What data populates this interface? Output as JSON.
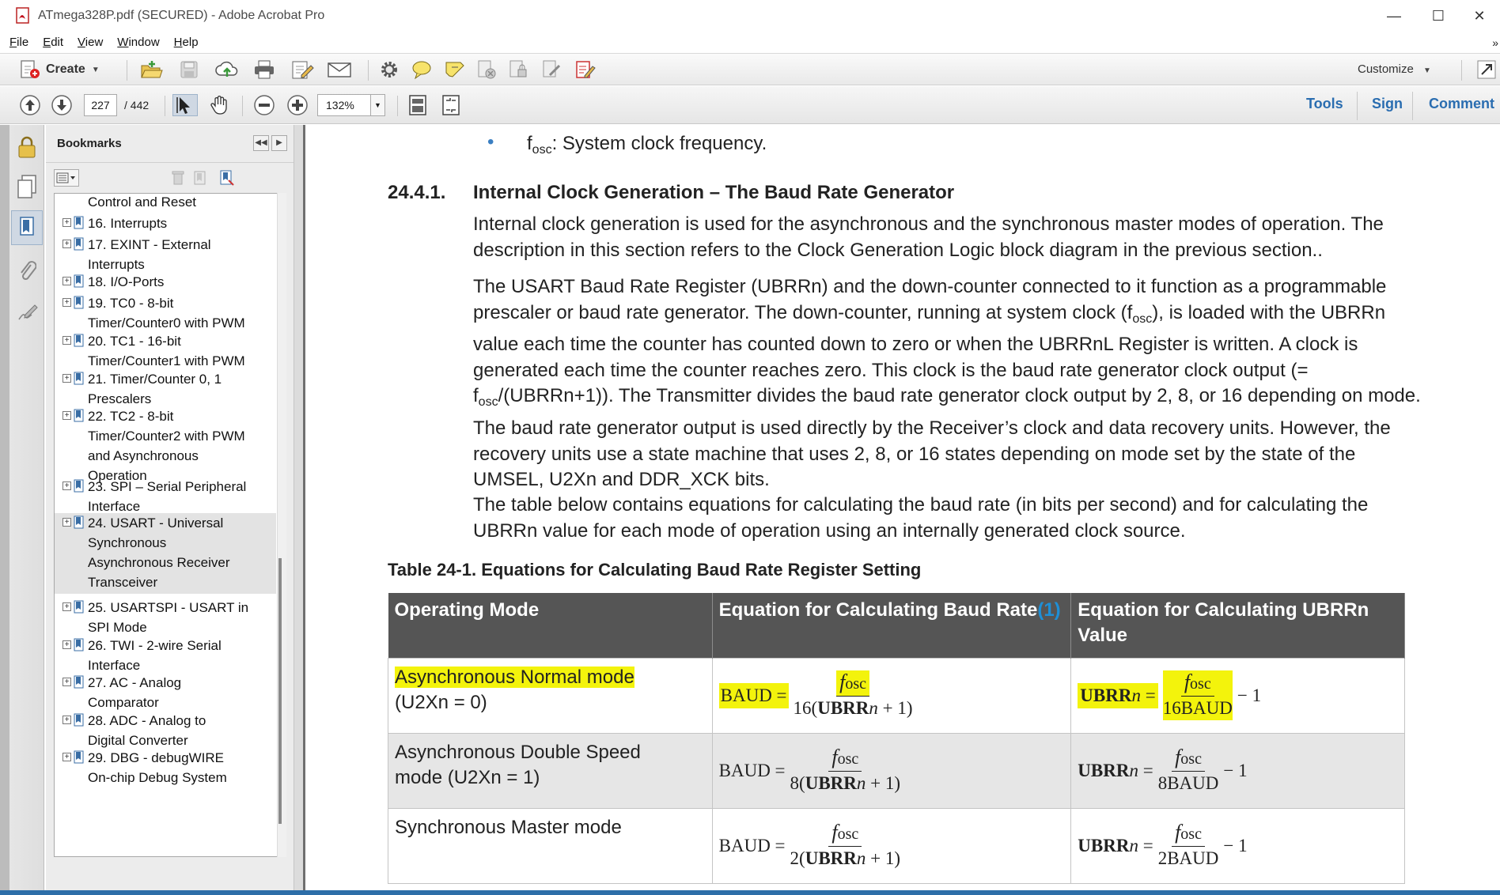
{
  "window": {
    "title": "ATmega328P.pdf (SECURED) - Adobe Acrobat Pro",
    "controls": {
      "minimize": "—",
      "maximize": "☐",
      "close": "✕"
    }
  },
  "menu": {
    "items": [
      {
        "key": "F",
        "rest": "ile"
      },
      {
        "key": "E",
        "rest": "dit"
      },
      {
        "key": "V",
        "rest": "iew"
      },
      {
        "key": "W",
        "rest": "indow"
      },
      {
        "key": "H",
        "rest": "elp"
      }
    ],
    "overflow": "»"
  },
  "toolbar": {
    "create_label": "Create",
    "customize_label": "Customize",
    "icons": [
      "open-folder-icon",
      "save-icon",
      "cloud-upload-icon",
      "print-icon",
      "edit-document-icon",
      "email-icon",
      "gear-icon",
      "comment-icon",
      "highlight-icon",
      "redact-icon",
      "secure-icon",
      "sign-icon",
      "pdf-form-icon"
    ]
  },
  "navigation": {
    "current_page": "227",
    "page_total": "/ 442",
    "zoom": "132%",
    "links": {
      "tools": "Tools",
      "sign": "Sign",
      "comment": "Comment"
    }
  },
  "bookmarks": {
    "title": "Bookmarks",
    "items": [
      {
        "lines": [
          "Control and Reset"
        ],
        "has_toggle": false,
        "selected": false
      },
      {
        "lines": [
          "16. Interrupts"
        ],
        "has_toggle": true,
        "selected": false
      },
      {
        "lines": [
          "17. EXINT - External",
          "Interrupts"
        ],
        "has_toggle": true,
        "selected": false
      },
      {
        "lines": [
          "18. I/O-Ports"
        ],
        "has_toggle": true,
        "selected": false
      },
      {
        "lines": [
          "19. TC0 - 8-bit",
          "Timer/Counter0 with PWM"
        ],
        "has_toggle": true,
        "selected": false
      },
      {
        "lines": [
          "20. TC1 - 16-bit",
          "Timer/Counter1 with PWM"
        ],
        "has_toggle": true,
        "selected": false
      },
      {
        "lines": [
          "21. Timer/Counter 0, 1",
          "Prescalers"
        ],
        "has_toggle": true,
        "selected": false
      },
      {
        "lines": [
          "22. TC2 - 8-bit",
          "Timer/Counter2 with PWM",
          "and Asynchronous",
          "Operation"
        ],
        "has_toggle": true,
        "selected": false
      },
      {
        "lines": [
          "23. SPI – Serial Peripheral",
          "Interface"
        ],
        "has_toggle": true,
        "selected": false
      },
      {
        "lines": [
          "24. USART - Universal",
          "Synchronous",
          "Asynchronous Receiver",
          "Transceiver"
        ],
        "has_toggle": true,
        "selected": true
      },
      {
        "lines": [
          "25. USARTSPI - USART in",
          "SPI Mode"
        ],
        "has_toggle": true,
        "selected": false
      },
      {
        "lines": [
          "26. TWI - 2-wire Serial",
          "Interface"
        ],
        "has_toggle": true,
        "selected": false
      },
      {
        "lines": [
          "27. AC - Analog",
          "Comparator"
        ],
        "has_toggle": true,
        "selected": false
      },
      {
        "lines": [
          "28. ADC - Analog to",
          "Digital Converter"
        ],
        "has_toggle": true,
        "selected": false
      },
      {
        "lines": [
          "29. DBG - debugWIRE",
          "On-chip Debug System"
        ],
        "has_toggle": true,
        "selected": false
      }
    ]
  },
  "document": {
    "bullet": {
      "symbol": "•",
      "term_main": "f",
      "term_sub": "osc",
      "text": ": System clock frequency."
    },
    "section_number": "24.4.1.",
    "section_title": "Internal Clock Generation – The Baud Rate Generator",
    "para1": "Internal clock generation is used for the asynchronous and the synchronous master modes of operation. The description in this section refers to the Clock Generation Logic block diagram in the previous section..",
    "para2": {
      "part1": "The USART Baud Rate Register (UBRRn) and the down-counter connected to it function as a programmable prescaler or baud rate generator. The down-counter, running at system clock (f",
      "sub1": "osc",
      "part2": "), is loaded with the UBRRn value each time the counter has counted down to zero or when the UBRRnL Register is written. A clock is generated each time the counter reaches zero. This clock is the baud rate generator clock output (= f",
      "sub2": "osc",
      "part3": "/(UBRRn+1)). The Transmitter divides the baud rate generator clock output by 2, 8, or 16 depending on mode. The baud rate generator output is used directly by the Receiver’s clock and data recovery units. However, the recovery units use a state machine that uses 2, 8, or 16 states depending on mode set by the state of the UMSEL, U2Xn and DDR_XCK bits."
    },
    "para3": "The table below contains equations for calculating the baud rate (in bits per second) and for calculating the UBRRn value for each mode of operation using an internally generated clock source.",
    "table_caption": "Table 24-1.  Equations for Calculating Baud Rate Register Setting",
    "table": {
      "headers": [
        "Operating Mode",
        "Equation for Calculating Baud Rate",
        "Equation for Calculating UBRRn Value"
      ],
      "header_ref": "(1)",
      "rows": [
        {
          "mode_line1": "Asynchronous Normal mode",
          "mode_line2": "(U2Xn = 0)",
          "highlighted": true,
          "baud_lhs": "BAUD =",
          "baud_den_num": "16",
          "ubrr_den": "16BAUD"
        },
        {
          "mode_line1": "Asynchronous Double Speed",
          "mode_line2": "mode (U2Xn = 1)",
          "highlighted": false,
          "baud_lhs": "BAUD =",
          "baud_den_num": "8",
          "ubrr_den": "8BAUD"
        },
        {
          "mode_line1": "Synchronous Master mode",
          "mode_line2": "",
          "highlighted": false,
          "baud_lhs": "BAUD =",
          "baud_den_num": "2",
          "ubrr_den": "2BAUD"
        }
      ],
      "formula": {
        "f": "f",
        "osc": "osc",
        "ubrr": "UBRR",
        "n": "n",
        "eq": "=",
        "minus_one": "− 1",
        "plus_one": "+ 1"
      }
    }
  }
}
